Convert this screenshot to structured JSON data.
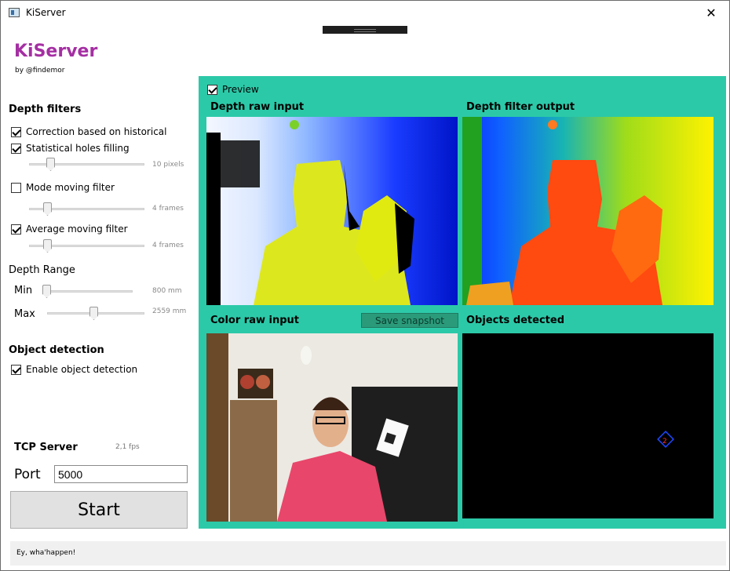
{
  "window": {
    "title": "KiServer",
    "close_glyph": "✕"
  },
  "brand": {
    "name": "KiServer",
    "byline": "by @findemor",
    "color": "#a52fa3"
  },
  "depth_filters": {
    "title": "Depth filters",
    "correction": {
      "label": "Correction based on historical",
      "checked": true
    },
    "holes": {
      "label": "Statistical holes filling",
      "checked": true,
      "value_text": "10 pixels",
      "level": 0.25
    },
    "mode": {
      "label": "Mode moving filter",
      "checked": false,
      "value_text": "4 frames",
      "level": 0.12
    },
    "average": {
      "label": "Average moving filter",
      "checked": true,
      "value_text": "4 frames",
      "level": 0.12
    }
  },
  "depth_range": {
    "title": "Depth Range",
    "min": {
      "label": "Min",
      "value_text": "800 mm",
      "level": 0.0
    },
    "max": {
      "label": "Max",
      "value_text": "2559 mm",
      "level": 0.5
    }
  },
  "object_detection": {
    "title": "Object detection",
    "enable": {
      "label": "Enable object detection",
      "checked": true
    }
  },
  "tcp": {
    "title": "TCP Server",
    "fps": "2,1 fps",
    "port_label": "Port",
    "port_value": "5000",
    "start_label": "Start"
  },
  "status": {
    "text": "Ey, wha'happen!"
  },
  "preview": {
    "checkbox_label": "Preview",
    "checked": true,
    "accent": "#2cc9a8",
    "depth_raw_title": "Depth raw input",
    "depth_filter_title": "Depth filter output",
    "color_raw_title": "Color raw input",
    "objects_title": "Objects detected",
    "snapshot_label": "Save snapshot",
    "detected_object_id": "2"
  }
}
